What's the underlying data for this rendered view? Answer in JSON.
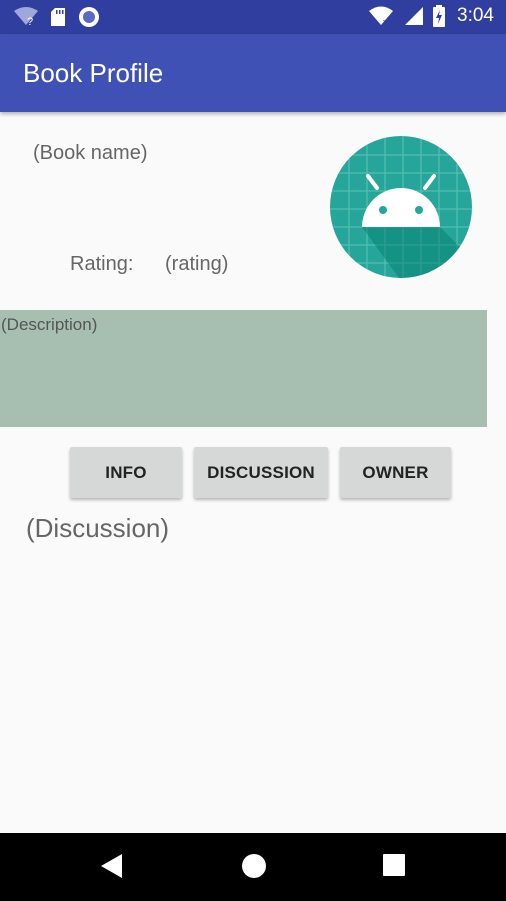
{
  "status_bar": {
    "time": "3:04",
    "icons": [
      "wifi-question-icon",
      "sd-card-icon",
      "sync-circle-icon",
      "wifi-icon",
      "signal-icon",
      "battery-charging-icon"
    ]
  },
  "app_bar": {
    "title": "Book Profile"
  },
  "book": {
    "name": "(Book name)",
    "rating_label": "Rating:",
    "rating_value": "(rating)",
    "image": "android-app-icon",
    "description": "(Description)"
  },
  "tabs": {
    "info": "INFO",
    "discussion": "DISCUSSION",
    "owner": "OWNER"
  },
  "discussion_text": "(Discussion)",
  "nav_bar": {
    "icons": [
      "back-icon",
      "home-icon",
      "recents-icon"
    ]
  },
  "colors": {
    "status_bar": "#303f9f",
    "app_bar": "#3f51b5",
    "description_bg": "#a7bfb0",
    "button_bg": "#d6d7d7",
    "android_icon_bg": "#26a69a"
  }
}
